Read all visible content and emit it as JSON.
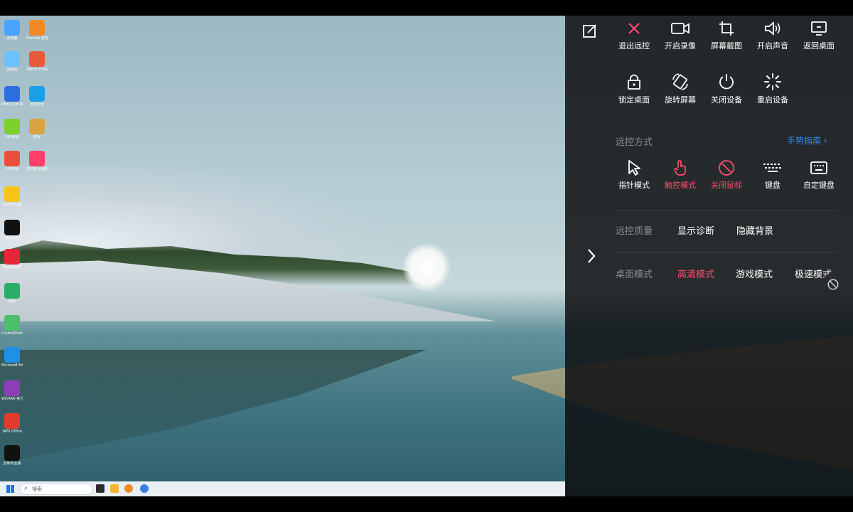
{
  "desktop": {
    "icons": [
      {
        "label": "此电脑",
        "icon": "computer-icon",
        "color": "#4aa3ff"
      },
      {
        "label": "Foxmail 管理端",
        "icon": "foxmail-icon",
        "color": "#f08a24"
      },
      {
        "label": "回收站",
        "icon": "recycle-bin-icon",
        "color": "#6ec1ff"
      },
      {
        "label": "ABBYY FineReader",
        "icon": "abbyy-icon",
        "color": "#e85a3c"
      },
      {
        "label": "Word 文档 新建",
        "icon": "word-icon",
        "color": "#2b6fe0"
      },
      {
        "label": "迅雷影音",
        "icon": "xunlei-icon",
        "color": "#1aa0e8"
      },
      {
        "label": "360极速",
        "icon": "speed-icon",
        "color": "#7ccf2c"
      },
      {
        "label": "游戏",
        "icon": "game-icon",
        "color": "#d9a441"
      },
      {
        "label": "360安全",
        "icon": "browser360-icon",
        "color": "#e94f3c"
      },
      {
        "label": "向日葵 远程控制",
        "icon": "sunlogin-icon",
        "color": "#ff3e6c"
      },
      {
        "label": "谷歌浏览器",
        "icon": "chrome-icon",
        "color": "#f5c518"
      },
      {
        "label": "腾讯QQ",
        "icon": "qq-icon",
        "color": "#111111"
      },
      {
        "label": "网易云音乐",
        "icon": "netease-music-icon",
        "color": "#e8253a"
      },
      {
        "label": "微信",
        "icon": "wechat-icon",
        "color": "#2aae67"
      },
      {
        "label": "CrystalDiskInfo",
        "icon": "crystal-icon",
        "color": "#4bbf6a"
      },
      {
        "label": "Microsoft Edge",
        "icon": "edge-icon",
        "color": "#1e90e8"
      },
      {
        "label": "WinRAR 官方版本",
        "icon": "winrar-icon",
        "color": "#8e3fb8"
      },
      {
        "label": "WPS Office",
        "icon": "wps-icon",
        "color": "#e23b2e"
      },
      {
        "label": "剪映专业版",
        "icon": "capcut-icon",
        "color": "#111111"
      }
    ]
  },
  "taskbar": {
    "search_placeholder": "搜索"
  },
  "control_panel": {
    "row1": [
      {
        "label": "退出远控",
        "icon": "close-icon"
      },
      {
        "label": "开启录像",
        "icon": "video-camera-icon"
      },
      {
        "label": "屏幕截图",
        "icon": "crop-icon"
      },
      {
        "label": "开启声音",
        "icon": "speaker-icon"
      },
      {
        "label": "返回桌面",
        "icon": "monitor-icon"
      }
    ],
    "row2": [
      {
        "label": "锁定桌面",
        "icon": "lock-icon"
      },
      {
        "label": "旋转屏幕",
        "icon": "rotate-screen-icon"
      },
      {
        "label": "关闭设备",
        "icon": "power-icon"
      },
      {
        "label": "重启设备",
        "icon": "restart-spinner-icon"
      }
    ],
    "remote_method": {
      "label": "远控方式",
      "guide_link": "手势指南 ›",
      "items": [
        {
          "label": "指针模式",
          "icon": "pointer-icon",
          "active": false
        },
        {
          "label": "触控模式",
          "icon": "touch-icon",
          "active": true
        },
        {
          "label": "关闭鼠标",
          "icon": "mouse-off-icon",
          "active": true
        },
        {
          "label": "键盘",
          "icon": "keyboard-icon",
          "active": false
        },
        {
          "label": "自定键盘",
          "icon": "custom-keyboard-icon",
          "active": false
        }
      ]
    },
    "remote_quality": {
      "label": "远控质量",
      "options": [
        "显示诊断",
        "隐藏背景"
      ]
    },
    "desktop_mode": {
      "label": "桌面模式",
      "options": [
        {
          "label": "高清模式",
          "active": true
        },
        {
          "label": "游戏模式",
          "active": false
        },
        {
          "label": "极速模式",
          "active": false
        }
      ]
    },
    "accent_color": "#ff4d6d",
    "link_color": "#2f8dff"
  }
}
